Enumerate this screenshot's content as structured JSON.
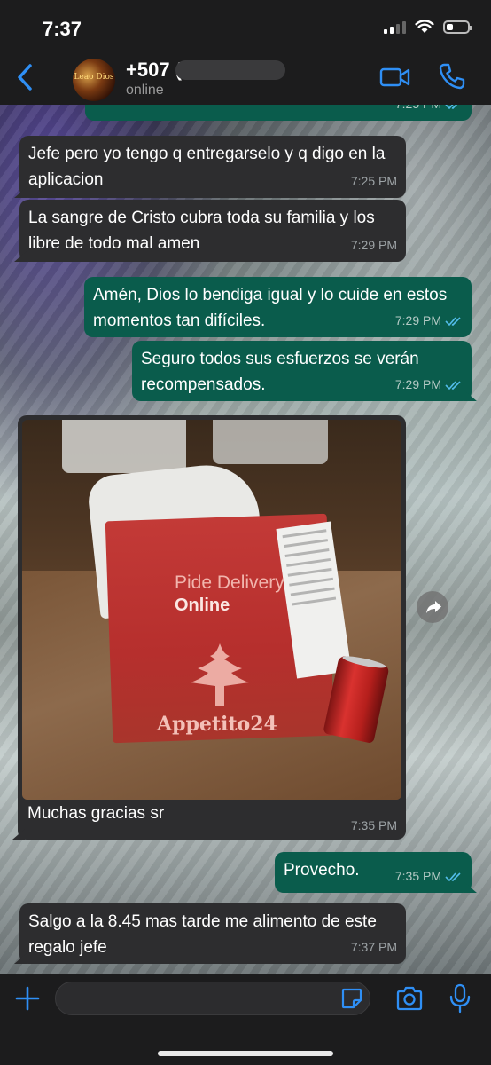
{
  "status_bar": {
    "time": "7:37"
  },
  "header": {
    "contact_name": "+507 (",
    "contact_status": "online",
    "avatar_text": "Leao Dios"
  },
  "messages": [
    {
      "direction": "out",
      "text": "",
      "time": "7:25 PM"
    },
    {
      "direction": "in",
      "text": "Jefe pero yo tengo q entregarselo y q digo en la aplicacion",
      "time": "7:25 PM"
    },
    {
      "direction": "in",
      "text": "La sangre de Cristo cubra toda su familia y los libre de todo mal amen",
      "time": "7:29 PM"
    },
    {
      "direction": "out",
      "text": "Amén, Dios lo bendiga igual y lo cuide en estos momentos tan difíciles.",
      "time": "7:29 PM"
    },
    {
      "direction": "out",
      "text": "Seguro todos sus esfuerzos se verán recompensados.",
      "time": "7:29 PM"
    },
    {
      "direction": "in",
      "type": "photo",
      "caption": "Muchas gracias sr",
      "time": "7:35 PM",
      "photo_text": {
        "bag_line1": "Pide Delivery",
        "bag_line2": "Online",
        "bag_brand": "Appetito24"
      }
    },
    {
      "direction": "out",
      "text": "Provecho.",
      "time": "7:35 PM"
    },
    {
      "direction": "in",
      "text": "Salgo a la 8.45 mas tarde me alimento de este regalo jefe",
      "time": "7:37 PM"
    }
  ],
  "composer": {
    "placeholder": ""
  },
  "colors": {
    "accent": "#2f8ff5",
    "incoming": "#2d2d2f",
    "outgoing": "#0a5c4c",
    "read_ticks": "#53bdeb"
  }
}
